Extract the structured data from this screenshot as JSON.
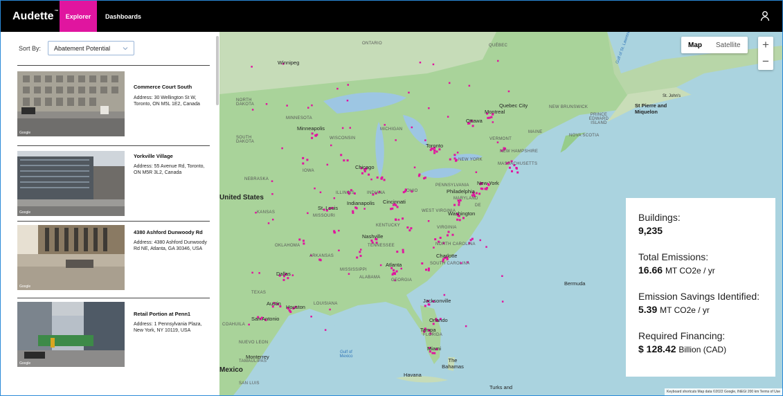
{
  "header": {
    "brand": "Audette",
    "brand_mark": "™",
    "tabs": [
      {
        "label": "Explorer",
        "active": true
      },
      {
        "label": "Dashboards",
        "active": false
      }
    ],
    "accent": "#e0159f"
  },
  "sidebar": {
    "sort_label": "Sort By:",
    "sort_value": "Abatement Potential",
    "cards": [
      {
        "name": "Commerce Court South",
        "address": "Address: 30 Wellington St W, Toronto, ON M5L 1E2, Canada",
        "photo_tag": "Google"
      },
      {
        "name": "Yorkville Village",
        "address": "Address: 55 Avenue Rd, Toronto, ON M5R 3L2, Canada",
        "photo_tag": "Google"
      },
      {
        "name": "4380 Ashford Dunwoody Rd",
        "address": "Address: 4380 Ashford Dunwoody Rd NE, Atlanta, GA 30346, USA",
        "photo_tag": "Google"
      },
      {
        "name": "Retail Portion at Penn1",
        "address": "Address: 1 Pennsylvania Plaza, New York, NY 10119, USA",
        "photo_tag": "Google"
      }
    ]
  },
  "map": {
    "type_buttons": {
      "map": "Map",
      "satellite": "Satellite"
    },
    "zoom_in": "+",
    "zoom_out": "−",
    "marker_color": "#e0159f",
    "labels": {
      "ontario": "ONTARIO",
      "quebec": "QUÉBEC",
      "north_dakota": "NORTH DAKOTA",
      "south_dakota": "SOUTH DAKOTA",
      "minnesota": "MINNESOTA",
      "wisconsin": "WISCONSIN",
      "michigan": "MICHIGAN",
      "iowa": "IOWA",
      "nebraska": "NEBRASKA",
      "kansas": "KANSAS",
      "missouri": "MISSOURI",
      "illinois": "ILLINOIS",
      "indiana": "INDIANA",
      "ohio": "OHIO",
      "pennsylvania": "PENNSYLVANIA",
      "new_york_state": "NEW YORK",
      "kentucky": "KENTUCKY",
      "tennessee": "TENNESSEE",
      "oklahoma": "OKLAHOMA",
      "arkansas": "ARKANSAS",
      "mississippi": "MISSISSIPPI",
      "alabama": "ALABAMA",
      "georgia": "GEORGIA",
      "texas": "TEXAS",
      "louisiana": "LOUISIANA",
      "florida": "FLORIDA",
      "west_virginia": "WEST VIRGINIA",
      "virginia": "VIRGINIA",
      "north_carolina": "NORTH CAROLINA",
      "south_carolina": "SOUTH CAROLINA",
      "maine": "MAINE",
      "vermont": "VERMONT",
      "new_hampshire": "NEW HAMPSHIRE",
      "massachusetts": "MASSACHUSETTS",
      "maryland": "MARYLAND",
      "new_brunswick": "NEW BRUNSWICK",
      "nova_scotia": "NOVA SCOTIA",
      "pei": "PRINCE EDWARD ISLAND",
      "coahuila": "COAHUILA",
      "nuevo_leon": "NUEVO LEON",
      "tamaulipas": "TAMAULIPAS",
      "san_luis": "SAN LUIS",
      "united_states": "United States",
      "mexico": "Mexico",
      "gulf_of_mexico": "Gulf of Mexico",
      "gulf_of_st_lawrence": "Gulf of St. Lawrence",
      "winnipeg": "Winnipeg",
      "minneapolis": "Minneapolis",
      "chicago": "Chicago",
      "st_louis": "St. Louis",
      "indianapolis": "Indianapolis",
      "cincinnati": "Cincinnati",
      "toronto": "Toronto",
      "ottawa": "Ottawa",
      "montreal": "Montreal",
      "quebec_city": "Quebec City",
      "new_york": "New York",
      "philadelphia": "Philadelphia",
      "washington": "Washington",
      "nashville": "Nashville",
      "charlotte": "Charlotte",
      "atlanta": "Atlanta",
      "dallas": "Dallas",
      "austin": "Austin",
      "houston": "Houston",
      "san_antonio": "San Antonio",
      "jacksonville": "Jacksonville",
      "orlando": "Orlando",
      "tampa": "Tampa",
      "miami": "Miami",
      "monterrey": "Monterrey",
      "havana": "Havana",
      "bahamas": "The Bahamas",
      "bermuda": "Bermuda",
      "st_johns": "St. John's",
      "st_pierre": "St Pierre and Miquelon",
      "turks": "Turks and",
      "de": "DE"
    },
    "attribution": "Keyboard shortcuts   Map data ©2022 Google, INEGI   200 km   Terms of Use"
  },
  "stats": {
    "buildings_label": "Buildings:",
    "buildings_value": "9,235",
    "emissions_label": "Total Emissions:",
    "emissions_value": "16.66",
    "emissions_unit": "MT CO2e / yr",
    "savings_label": "Emission Savings Identified:",
    "savings_value": "5.39",
    "savings_unit": "MT CO2e / yr",
    "financing_label": "Required Financing:",
    "financing_value": "$ 128.42",
    "financing_unit": "Billion (CAD)"
  }
}
